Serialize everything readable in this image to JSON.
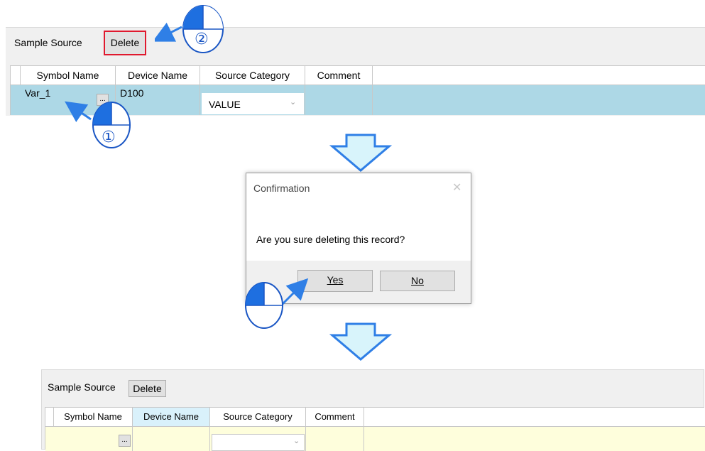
{
  "top_panel": {
    "label": "Sample Source",
    "delete_label": "Delete",
    "columns": [
      "Symbol Name",
      "Device Name",
      "Source Category",
      "Comment"
    ],
    "row": {
      "symbol": "Var_1",
      "ellipsis": "...",
      "device": "D100",
      "category": "VALUE",
      "comment": ""
    },
    "row_color": "#add8e6"
  },
  "dialog": {
    "title": "Confirmation",
    "close_glyph": "✕",
    "message": "Are you sure deleting this record?",
    "yes_label": "Yes",
    "no_label": "No"
  },
  "bottom_panel": {
    "label": "Sample Source",
    "delete_label": "Delete",
    "columns": [
      "Symbol Name",
      "Device Name",
      "Source Category",
      "Comment"
    ],
    "row": {
      "ellipsis": "...",
      "category": ""
    },
    "row_color": "#fefedc"
  },
  "annotations": {
    "step1": "①",
    "step2": "②",
    "highlight_color": "#e0192e",
    "arrow_color": "#2f7fe6",
    "flow_arrow_fill": "#d8f4fb"
  }
}
